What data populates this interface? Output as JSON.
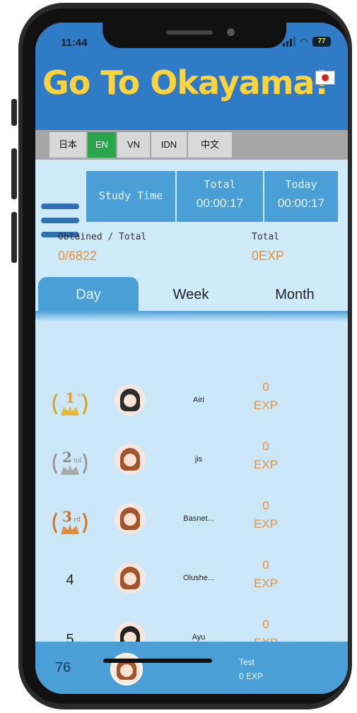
{
  "status_bar": {
    "time": "11:44",
    "battery": "77"
  },
  "app": {
    "title": "Go To Okayama!"
  },
  "languages": [
    {
      "label": "日本",
      "active": false
    },
    {
      "label": "EN",
      "active": true
    },
    {
      "label": "VN",
      "active": false
    },
    {
      "label": "IDN",
      "active": false
    },
    {
      "label": "中文",
      "active": false
    }
  ],
  "study": {
    "label": "Study Time",
    "total_label": "Total",
    "total_value": "00:00:17",
    "today_label": "Today",
    "today_value": "00:00:17"
  },
  "obtained": {
    "label": "Obtained / Total",
    "value": "0/6822"
  },
  "total_exp": {
    "label": "Total",
    "value": "0EXP"
  },
  "tabs": [
    {
      "label": "Day",
      "active": true
    },
    {
      "label": "Week",
      "active": false
    },
    {
      "label": "Month",
      "active": false
    }
  ],
  "ranking": [
    {
      "rank": "1st",
      "name": "Airi",
      "exp": "0",
      "unit": "EXP"
    },
    {
      "rank": "2nd",
      "name": "jis",
      "exp": "0",
      "unit": "EXP"
    },
    {
      "rank": "3rd",
      "name": "Basnet...",
      "exp": "0",
      "unit": "EXP"
    },
    {
      "rank": "4",
      "name": "Olushe...",
      "exp": "0",
      "unit": "EXP"
    },
    {
      "rank": "5",
      "name": "Ayu",
      "exp": "0",
      "unit": "EXP"
    }
  ],
  "current_user": {
    "rank": "76",
    "name": "Test",
    "exp": "0 EXP"
  },
  "colors": {
    "header": "#2f7bc6",
    "title": "#ffd43b",
    "accent": "#4aa0d6",
    "exp": "#e8913b",
    "active_lang": "#2aa64a"
  }
}
